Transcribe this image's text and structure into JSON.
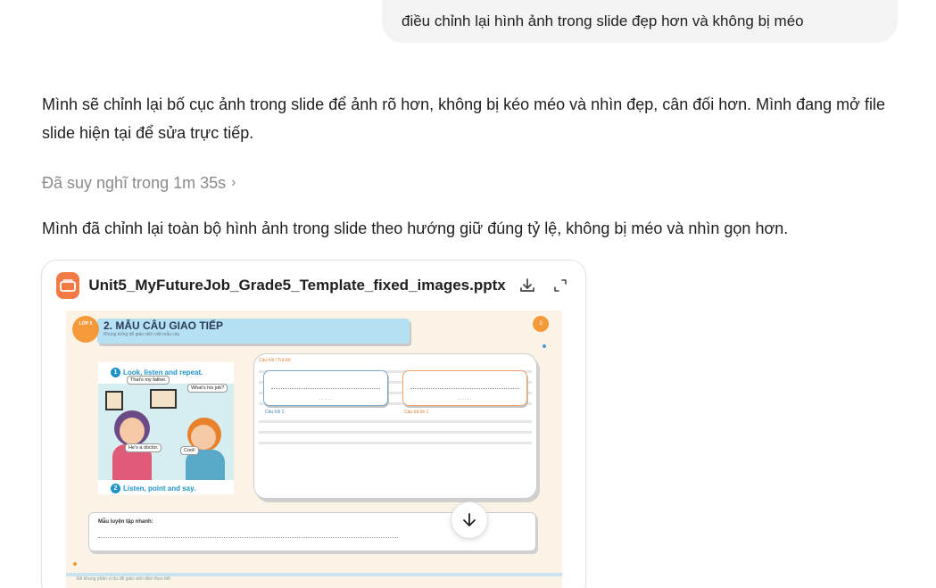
{
  "user_message": "điều chỉnh lại hình ảnh trong slide đẹp hơn và không bị méo",
  "assistant": {
    "intro": "Mình sẽ chỉnh lại bố cục ảnh trong slide để ảnh rõ hơn, không bị kéo méo và nhìn đẹp, cân đối hơn. Mình đang mở file slide hiện tại để sửa trực tiếp.",
    "thinking_label": "Đã suy nghĩ trong 1m 35s",
    "result": "Mình đã chỉnh lại toàn bộ hình ảnh trong slide theo hướng giữ đúng tỷ lệ, không bị méo và nhìn gọn hơn."
  },
  "file_card": {
    "filename": "Unit5_MyFutureJob_Grade5_Template_fixed_images.pptx",
    "icon": "presentation-file-icon",
    "accent_color": "#f47a45"
  },
  "slide": {
    "badge": "LỚP 5",
    "title": "2. MẪU CÂU GIAO TIẾP",
    "subtitle": "Khung trống để giáo viên viết mẫu câu",
    "page_number": "3",
    "textbook": {
      "heading1_num": "1",
      "heading1": "Look, listen and repeat.",
      "bubble_father": "That's my father.",
      "bubble_job": "What's his job?",
      "bubble_doctor": "He's a doctor.",
      "bubble_cool": "Cool!",
      "heading2_num": "2",
      "heading2": "Listen, point and say."
    },
    "qa": {
      "label": "Câu hỏi / Trả lời",
      "question_dash": "......",
      "answer_dash": "......",
      "question_caption": "Câu hỏi 1",
      "answer_caption": "Câu trả lời 1"
    },
    "practice_label": "Mẫu luyện tập nhanh:",
    "footer_note": "Để khung phân vị dự để giáo viên điền theo tiết"
  }
}
